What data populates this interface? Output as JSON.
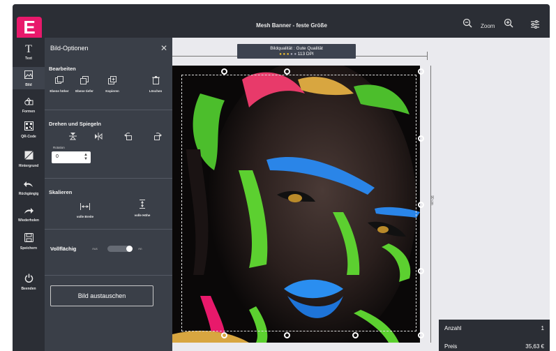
{
  "app": {
    "logo": "E",
    "title": "Mesh Banner - feste Größe"
  },
  "toolbar": {
    "zoom_label": "Zoom",
    "zoom_out_icon": "zoom-out-icon",
    "zoom_in_icon": "zoom-in-icon",
    "settings_icon": "sliders-icon"
  },
  "sidebar": {
    "items": [
      {
        "label": "Text",
        "icon": "text-icon"
      },
      {
        "label": "Bild",
        "icon": "image-icon"
      },
      {
        "label": "Formen",
        "icon": "shapes-icon"
      },
      {
        "label": "QR-Code",
        "icon": "qr-code-icon"
      },
      {
        "label": "Hintergrund",
        "icon": "background-icon"
      },
      {
        "label": "Rückgängig",
        "icon": "undo-icon"
      },
      {
        "label": "Wiederholen",
        "icon": "redo-icon"
      },
      {
        "label": "Speichern",
        "icon": "save-icon"
      },
      {
        "label": "Beenden",
        "icon": "power-icon"
      }
    ]
  },
  "panel": {
    "title": "Bild-Optionen",
    "edit": {
      "title": "Bearbeiten",
      "tools": [
        {
          "label": "Ebene höher",
          "icon": "layer-up-icon"
        },
        {
          "label": "Ebene tiefer",
          "icon": "layer-down-icon"
        },
        {
          "label": "Kopieren",
          "icon": "copy-icon"
        },
        {
          "label": "Löschen",
          "icon": "trash-icon"
        }
      ]
    },
    "rotate": {
      "title": "Drehen und Spiegeln",
      "rotation_label": "Rotation",
      "rotation_value": "0"
    },
    "scale": {
      "title": "Skalieren",
      "full_width": "volle Breite",
      "full_height": "volle Höhe"
    },
    "fill": {
      "label": "Vollflächig",
      "off": "Aus",
      "on": "An",
      "enabled": true
    },
    "swap_button": "Bild austauschen"
  },
  "canvas": {
    "quality_line1": "Bildqualität : Gute Qualität",
    "quality_rating": 3,
    "quality_max": 5,
    "quality_dpi": "113 DPI",
    "height_label": "90 cm"
  },
  "summary": {
    "qty_label": "Anzahl",
    "qty_value": "1",
    "price_label": "Preis",
    "price_value": "35,63 €"
  },
  "colors": {
    "brand": "#e8196b",
    "dark": "#2b2e35",
    "panel": "#3a3f48"
  }
}
